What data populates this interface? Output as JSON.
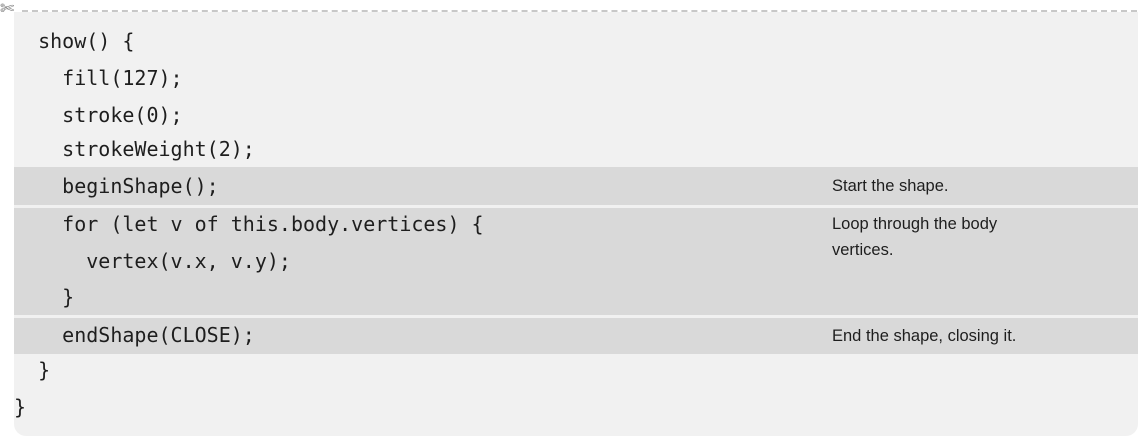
{
  "code": {
    "lines": [
      "  show() {",
      "    fill(127);",
      "    stroke(0);",
      "    strokeWeight(2);",
      "    beginShape();",
      "    for (let v of this.body.vertices) {",
      "      vertex(v.x, v.y);",
      "    }",
      "    endShape(CLOSE);",
      "  }",
      "}"
    ]
  },
  "annotations": [
    "Start the shape.",
    "Loop through the body vertices.",
    "End the shape, closing it."
  ]
}
